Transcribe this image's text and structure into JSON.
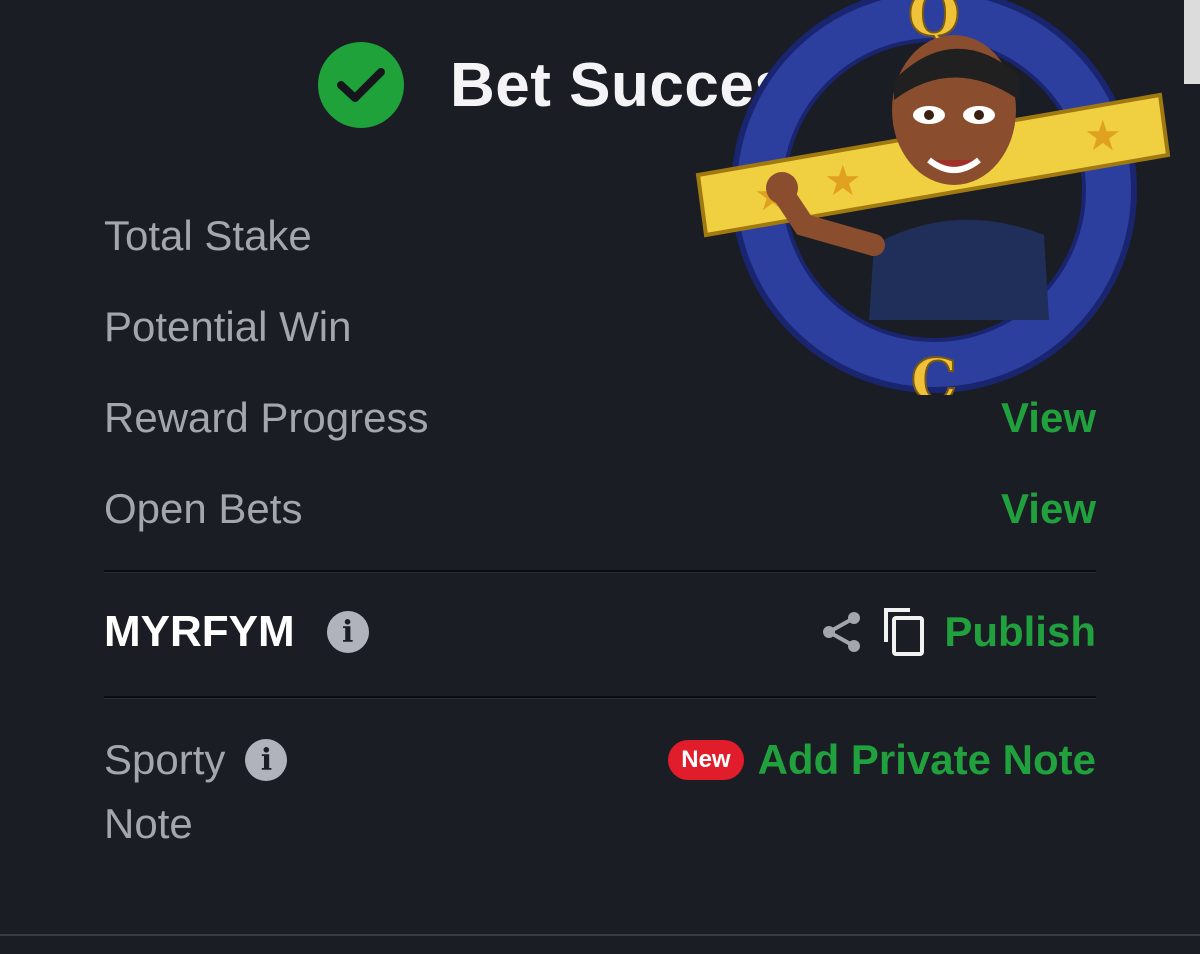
{
  "header": {
    "title": "Bet Successful"
  },
  "rows": [
    {
      "label": "Total Stake",
      "value": ""
    },
    {
      "label": "Potential Win",
      "value": ""
    },
    {
      "label": "Reward Progress",
      "link": "View"
    },
    {
      "label": "Open Bets",
      "link": "View"
    }
  ],
  "booking": {
    "code": "MYRFYM",
    "publish_label": "Publish"
  },
  "note": {
    "label_line1": "Sporty",
    "label_line2": "Note",
    "new_badge": "New",
    "add_note_label": "Add Private Note"
  },
  "overlay": {
    "top_text": "QUALITY",
    "bottom_text": "CONTENT"
  },
  "colors": {
    "background": "#1b1d24",
    "accent_green": "#21a03e",
    "badge_red": "#e21d2b",
    "success_green": "#1fa23a"
  },
  "icons": [
    "check-circle-icon",
    "info-icon",
    "share-icon",
    "copy-icon"
  ]
}
